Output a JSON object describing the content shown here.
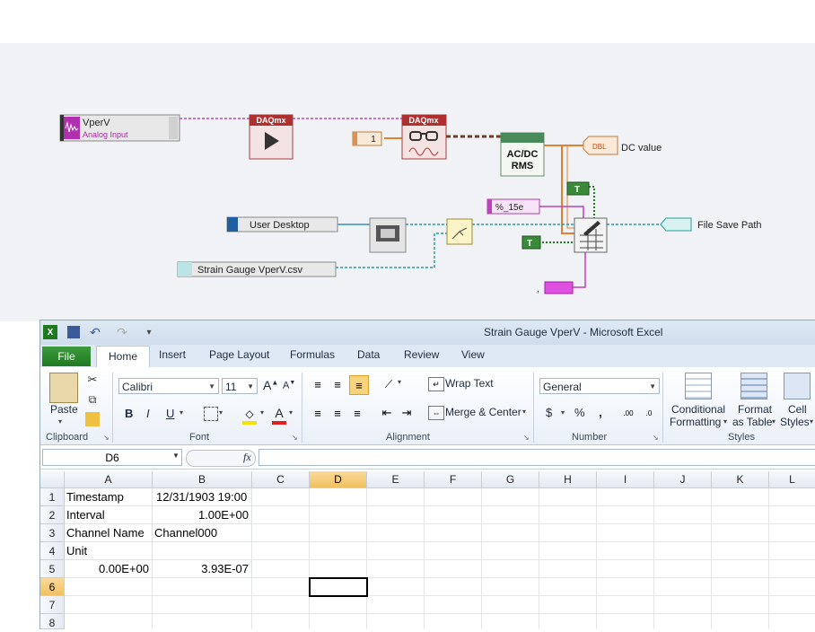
{
  "labview": {
    "analog_input": {
      "name": "VperV",
      "type": "Analog Input"
    },
    "daqmx_start_label": "DAQmx",
    "daqmx_read_label": "DAQmx",
    "samples_constant": "1",
    "acdc_label_line1": "AC/DC",
    "acdc_label_line2": "RMS",
    "dbl_indicator_tag": "DBL",
    "dc_value_label": "DC value",
    "format_string": "%_15e",
    "true_constant_1": "T",
    "true_constant_2": "T",
    "user_desktop_label": "User Desktop",
    "file_save_path_label": "File Save Path",
    "filename_constant": "Strain Gauge VperV.csv",
    "delimiter_label": ","
  },
  "excel": {
    "window_title": "Strain Gauge VperV  -  Microsoft Excel",
    "tabs": [
      "File",
      "Home",
      "Insert",
      "Page Layout",
      "Formulas",
      "Data",
      "Review",
      "View"
    ],
    "ribbon": {
      "clipboard": {
        "label": "Clipboard",
        "paste": "Paste"
      },
      "font": {
        "label": "Font",
        "font_name": "Calibri",
        "font_size": "11",
        "bold": "B",
        "italic": "I",
        "underline": "U"
      },
      "alignment": {
        "label": "Alignment",
        "wrap_text": "Wrap Text",
        "merge_center": "Merge & Center"
      },
      "number": {
        "label": "Number",
        "format": "General",
        "currency": "$",
        "percent": "%",
        "comma": ","
      },
      "styles": {
        "label": "Styles",
        "conditional_formatting_1": "Conditional",
        "conditional_formatting_2": "Formatting",
        "format_as_table_1": "Format",
        "format_as_table_2": "as Table",
        "cell_styles_1": "Cell",
        "cell_styles_2": "Styles"
      }
    },
    "name_box": "D6",
    "fx_label": "fx",
    "columns": [
      "A",
      "B",
      "C",
      "D",
      "E",
      "F",
      "G",
      "H",
      "I",
      "J",
      "K",
      "L"
    ],
    "rows": [
      "1",
      "2",
      "3",
      "4",
      "5",
      "6",
      "7",
      "8"
    ],
    "cells": {
      "A1": "Timestamp",
      "B1": "12/31/1903 19:00",
      "A2": "Interval",
      "B2": "1.00E+00",
      "A3": "Channel Name",
      "B3": "Channel000",
      "A4": "Unit",
      "A5": "0.00E+00",
      "B5": "3.93E-07"
    }
  }
}
